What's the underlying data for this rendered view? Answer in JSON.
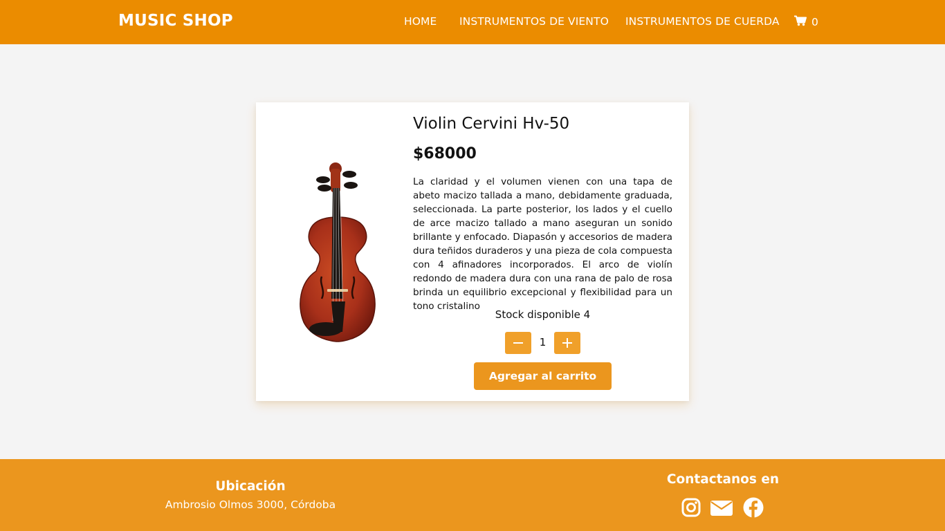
{
  "header": {
    "brand": "MUSIC SHOP",
    "nav": [
      {
        "label": "HOME"
      },
      {
        "label": "INSTRUMENTOS DE VIENTO"
      },
      {
        "label": "INSTRUMENTOS DE CUERDA"
      }
    ],
    "cart": {
      "icon": "cart-icon",
      "count": "0"
    }
  },
  "product": {
    "title": "Violin Cervini Hv-50",
    "price": "$68000",
    "description": "La claridad y el volumen vienen con una tapa de abeto macizo tallada a mano, debidamente graduada, seleccionada. La parte posterior, los lados y el cuello de arce macizo tallado a mano aseguran un sonido brillante y enfocado. Diapasón y accesorios de madera dura teñidos duraderos y una pieza de cola compuesta con 4 afinadores incorporados. El arco de violín redondo de madera dura con una rana de palo de rosa brinda un equilibrio excepcional y flexibilidad para un tono cristalino",
    "stock": "Stock disponible 4",
    "quantity": "1",
    "add_button": "Agregar al carrito"
  },
  "footer": {
    "location_title": "Ubicación",
    "location_address": "Ambrosio Olmos 3000, Córdoba",
    "contact_title": "Contactanos en",
    "social": [
      {
        "icon": "instagram-icon"
      },
      {
        "icon": "mail-icon"
      },
      {
        "icon": "facebook-icon"
      }
    ]
  },
  "colors": {
    "header": "#eb8c00",
    "accent": "#eb961e",
    "background": "#f4f4f4",
    "card": "#ffffff"
  }
}
